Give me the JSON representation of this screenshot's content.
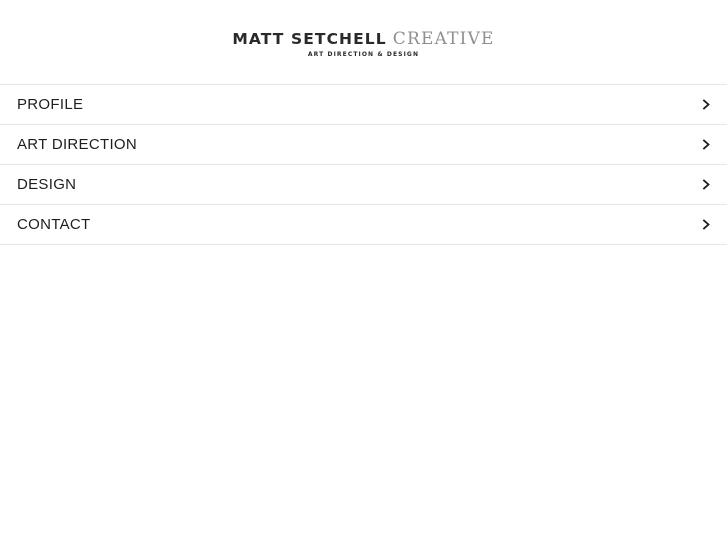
{
  "logo": {
    "name": "MATT SETCHELL",
    "creative": "CREATIVE",
    "tagline": "ART DIRECTION & DESIGN"
  },
  "nav": {
    "items": [
      {
        "label": "PROFILE",
        "icon": "chevron-right-icon"
      },
      {
        "label": "ART DIRECTION",
        "icon": "chevron-right-icon"
      },
      {
        "label": "DESIGN",
        "icon": "chevron-right-icon"
      },
      {
        "label": "CONTACT",
        "icon": "chevron-right-icon"
      }
    ]
  },
  "colors": {
    "text": "#1e1e1e",
    "logo_accent": "#8f8f8f",
    "divider": "#e6e6e6",
    "background": "#ffffff"
  }
}
